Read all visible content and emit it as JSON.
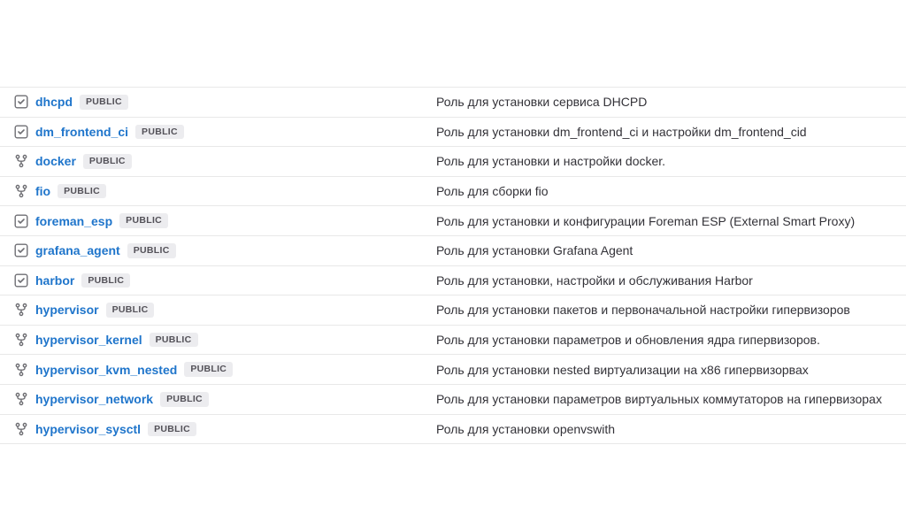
{
  "badge_label": "PUBLIC",
  "repos": [
    {
      "icon": "project",
      "name": "dhcpd",
      "desc": "Роль для установки сервиса DHCPD"
    },
    {
      "icon": "project",
      "name": "dm_frontend_ci",
      "desc": "Роль для установки dm_frontend_ci и настройки dm_frontend_cid"
    },
    {
      "icon": "fork",
      "name": "docker",
      "desc": "Роль для установки и настройки docker."
    },
    {
      "icon": "fork",
      "name": "fio",
      "desc": "Роль для сборки fio"
    },
    {
      "icon": "project",
      "name": "foreman_esp",
      "desc": "Роль для установки и конфигурации Foreman ESP (External Smart Proxy)"
    },
    {
      "icon": "project",
      "name": "grafana_agent",
      "desc": "Роль для установки Grafana Agent"
    },
    {
      "icon": "project",
      "name": "harbor",
      "desc": "Роль для установки, настройки и обслуживания Harbor"
    },
    {
      "icon": "fork",
      "name": "hypervisor",
      "desc": "Роль для установки пакетов и первоначальной настройки гипервизоров"
    },
    {
      "icon": "fork",
      "name": "hypervisor_kernel",
      "desc": "Роль для установки параметров и обновления ядра гипервизоров."
    },
    {
      "icon": "fork",
      "name": "hypervisor_kvm_nested",
      "desc": "Роль для установки nested виртуализации на x86 гипервизорвах"
    },
    {
      "icon": "fork",
      "name": "hypervisor_network",
      "desc": "Роль для установки параметров виртуальных коммутаторов на гипервизорах"
    },
    {
      "icon": "fork",
      "name": "hypervisor_sysctl",
      "desc": "Роль для установки openvswith"
    }
  ]
}
